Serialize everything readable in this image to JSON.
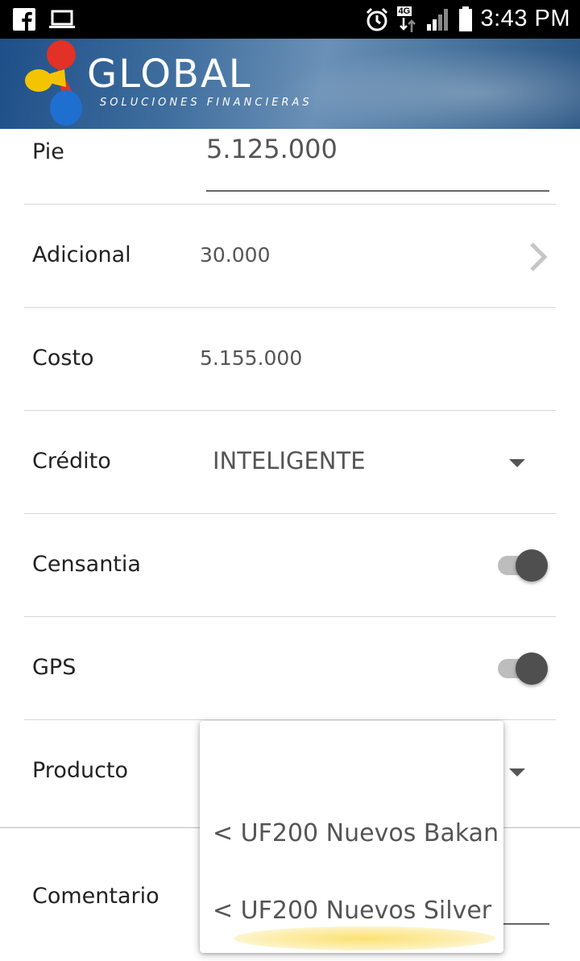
{
  "status_bar": {
    "time": "3:43 PM",
    "network_label": "4G",
    "icons": [
      "facebook-icon",
      "laptop-icon",
      "alarm-icon",
      "network-4g-icon",
      "signal-icon",
      "battery-icon"
    ]
  },
  "header": {
    "brand": "GLOBAL",
    "tagline": "SOLUCIONES FINANCIERAS"
  },
  "form": {
    "pie": {
      "label": "Pie",
      "value": "5.125.000"
    },
    "adicional": {
      "label": "Adicional",
      "value": "30.000"
    },
    "costo": {
      "label": "Costo",
      "value": "5.155.000"
    },
    "credito": {
      "label": "Crédito",
      "value": "INTELIGENTE"
    },
    "censantia": {
      "label": "Censantia",
      "on": true
    },
    "gps": {
      "label": "GPS",
      "on": true
    },
    "producto": {
      "label": "Producto",
      "value": ""
    },
    "comentario": {
      "label": "Comentario",
      "value": ""
    }
  },
  "producto_dropdown": {
    "options": [
      "",
      "< UF200 Nuevos Bakan",
      "< UF200 Nuevos Silver"
    ]
  },
  "colors": {
    "status_bar_bg": "#000000",
    "banner_blue": "#3f6e9e",
    "toggle_knob": "#4f4f4f",
    "toggle_track": "#bdbdbd"
  }
}
